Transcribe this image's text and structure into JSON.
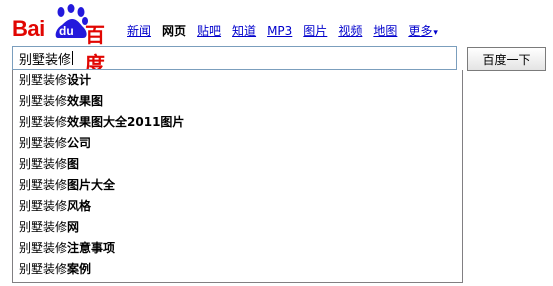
{
  "logo": {
    "latin": "Bai",
    "du": "du",
    "chinese": "百度",
    "colors": {
      "red": "#e10602",
      "blue": "#2319dc"
    }
  },
  "nav": {
    "items": [
      {
        "label": "新闻",
        "current": false
      },
      {
        "label": "网页",
        "current": true
      },
      {
        "label": "贴吧",
        "current": false
      },
      {
        "label": "知道",
        "current": false
      },
      {
        "label": "MP3",
        "current": false
      },
      {
        "label": "图片",
        "current": false
      },
      {
        "label": "视频",
        "current": false
      },
      {
        "label": "地图",
        "current": false
      }
    ],
    "more_label": "更多",
    "more_arrow": "▾"
  },
  "search": {
    "value": "别墅装修",
    "button_label": "百度一下"
  },
  "suggestions": [
    {
      "base": "别墅装修",
      "rest": "设计"
    },
    {
      "base": "别墅装修",
      "rest": "效果图"
    },
    {
      "base": "别墅装修",
      "rest": "效果图大全2011图片"
    },
    {
      "base": "别墅装修",
      "rest": "公司"
    },
    {
      "base": "别墅装修",
      "rest": "图"
    },
    {
      "base": "别墅装修",
      "rest": "图片大全"
    },
    {
      "base": "别墅装修",
      "rest": "风格"
    },
    {
      "base": "别墅装修",
      "rest": "网"
    },
    {
      "base": "别墅装修",
      "rest": "注意事项"
    },
    {
      "base": "别墅装修",
      "rest": "案例"
    }
  ]
}
